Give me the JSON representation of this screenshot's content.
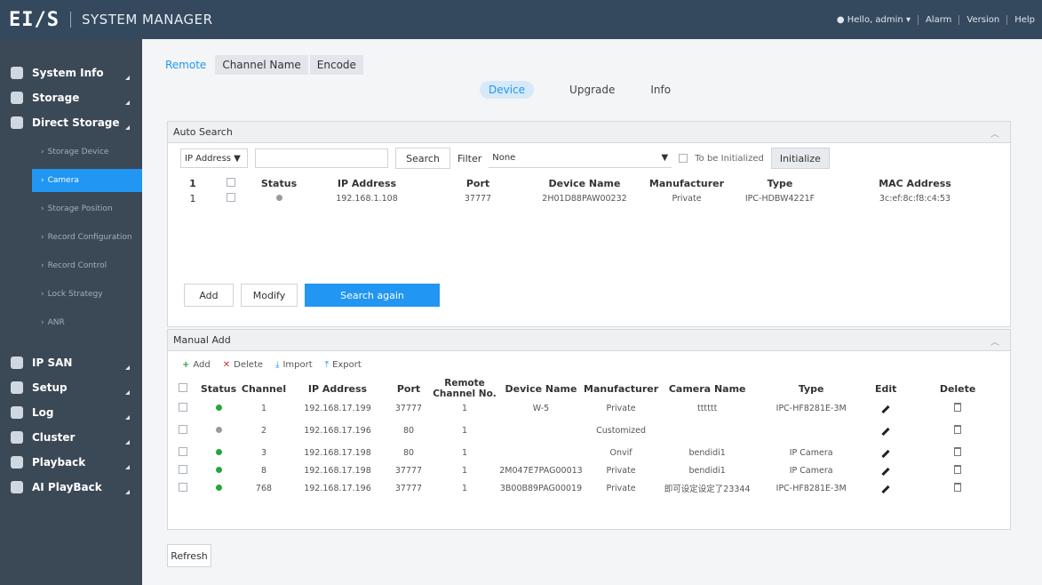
{
  "header": {
    "logo": "EI/S",
    "title": "SYSTEM MANAGER",
    "user": "Hello, admin",
    "links": [
      "Alarm",
      "Version",
      "Help"
    ]
  },
  "sidebar": {
    "groups": [
      {
        "label": "System Info",
        "icon": "info-icon"
      },
      {
        "label": "Storage",
        "icon": "disk-icon"
      },
      {
        "label": "Direct Storage",
        "icon": "monitor-icon"
      }
    ],
    "subitems": [
      {
        "label": "Storage Device",
        "active": false
      },
      {
        "label": "Camera",
        "active": true
      },
      {
        "label": "Storage Position",
        "active": false
      },
      {
        "label": "Record Configuration",
        "active": false
      },
      {
        "label": "Record Control",
        "active": false
      },
      {
        "label": "Lock Strategy",
        "active": false
      },
      {
        "label": "ANR",
        "active": false
      }
    ],
    "groups2": [
      {
        "label": "IP SAN",
        "icon": "server-icon"
      },
      {
        "label": "Setup",
        "icon": "gear-icon"
      },
      {
        "label": "Log",
        "icon": "document-icon"
      },
      {
        "label": "Cluster",
        "icon": "cluster-icon"
      },
      {
        "label": "Playback",
        "icon": "film-icon"
      },
      {
        "label": "AI PlayBack",
        "icon": "ai-icon"
      }
    ]
  },
  "top_tabs": [
    "Remote",
    "Channel Name",
    "Encode"
  ],
  "center_tabs": [
    "Device",
    "Upgrade",
    "Info"
  ],
  "auto_search": {
    "title": "Auto Search",
    "search_type": "IP Address",
    "search_input": "",
    "search_button": "Search",
    "filter_label": "Filter",
    "filter_value": "None",
    "to_be_initialized": "To be Initialized",
    "initialize_button": "Initialize",
    "columns": [
      "1",
      "",
      "Status",
      "IP Address",
      "Port",
      "Device Name",
      "Manufacturer",
      "Type",
      "MAC Address"
    ],
    "rows": [
      {
        "no": "1",
        "status": "gray",
        "ip": "192.168.1.108",
        "port": "37777",
        "device_name": "2H01D88PAW00232",
        "manufacturer": "Private",
        "type": "IPC-HDBW4221F",
        "mac": "3c:ef:8c:f8:c4:53"
      }
    ],
    "buttons": {
      "add": "Add",
      "modify": "Modify",
      "search_again": "Search again"
    }
  },
  "manual_add": {
    "title": "Manual Add",
    "toolbar": {
      "add": "Add",
      "delete": "Delete",
      "import": "Import",
      "export": "Export"
    },
    "columns": [
      "",
      "Status",
      "Channel",
      "IP Address",
      "Port",
      "Remote Channel No.",
      "Device Name",
      "Manufacturer",
      "Camera Name",
      "Type",
      "Edit",
      "Delete"
    ],
    "rows": [
      {
        "status": "green",
        "channel": "1",
        "ip": "192.168.17.199",
        "port": "37777",
        "remote": "1",
        "device_name": "W-5",
        "manufacturer": "Private",
        "camera_name": "tttttt",
        "type": "IPC-HF8281E-3M"
      },
      {
        "status": "gray",
        "channel": "2",
        "ip": "192.168.17.196",
        "port": "80",
        "remote": "1",
        "device_name": "",
        "manufacturer": "Customized",
        "camera_name": "",
        "type": ""
      },
      {
        "status": "green",
        "channel": "3",
        "ip": "192.168.17.198",
        "port": "80",
        "remote": "1",
        "device_name": "",
        "manufacturer": "Onvif",
        "camera_name": "bendidi1",
        "type": "IP Camera"
      },
      {
        "status": "green",
        "channel": "8",
        "ip": "192.168.17.198",
        "port": "37777",
        "remote": "1",
        "device_name": "2M047E7PAG00013",
        "manufacturer": "Private",
        "camera_name": "bendidi1",
        "type": "IP Camera"
      },
      {
        "status": "green",
        "channel": "768",
        "ip": "192.168.17.196",
        "port": "37777",
        "remote": "1",
        "device_name": "3B00B89PAG00019",
        "manufacturer": "Private",
        "camera_name": "即可设定设定了23344",
        "type": "IPC-HF8281E-3M"
      }
    ]
  },
  "refresh_button": "Refresh",
  "colors": {
    "accent": "#2196f3",
    "header": "#34495e",
    "sidebar": "#3b4856",
    "online": "#22a83a",
    "offline": "#9a9a9a"
  }
}
